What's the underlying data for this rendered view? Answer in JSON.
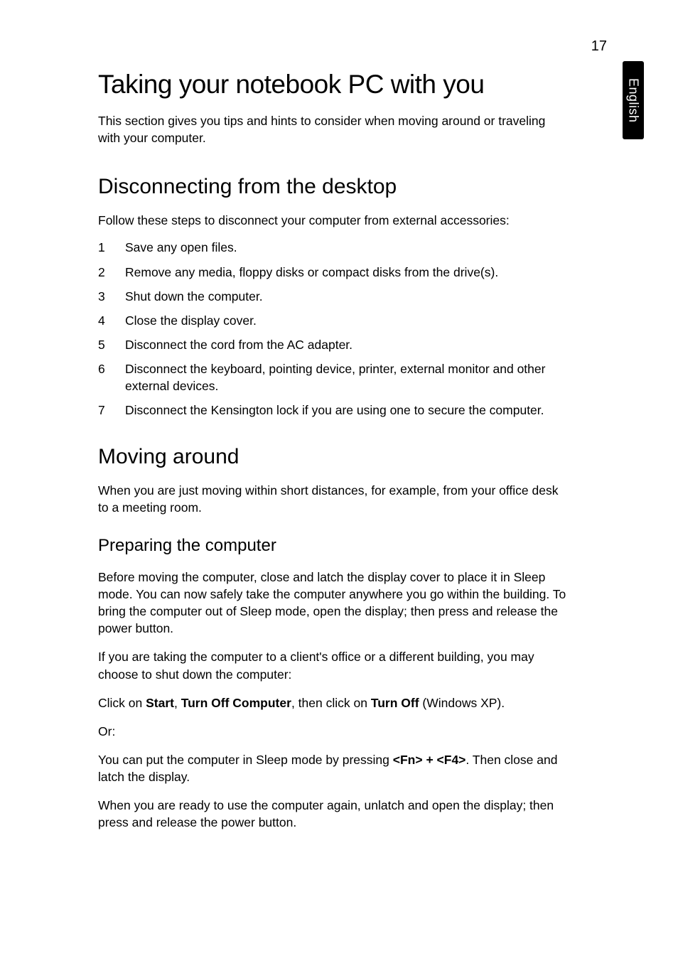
{
  "page_number": "17",
  "side_tab": "English",
  "h1": "Taking your notebook PC with you",
  "intro": "This section gives you tips and hints to consider when moving around or traveling with your computer.",
  "section1": {
    "heading": "Disconnecting from the desktop",
    "lead": "Follow these steps to disconnect your computer from external accessories:",
    "items": [
      {
        "n": "1",
        "t": "Save any open files."
      },
      {
        "n": "2",
        "t": "Remove any media, floppy disks or compact disks from the drive(s)."
      },
      {
        "n": "3",
        "t": "Shut down the computer."
      },
      {
        "n": "4",
        "t": "Close the display cover."
      },
      {
        "n": "5",
        "t": "Disconnect the cord from the AC adapter."
      },
      {
        "n": "6",
        "t": "Disconnect the keyboard, pointing device, printer, external monitor and other external devices."
      },
      {
        "n": "7",
        "t": "Disconnect the Kensington lock if you are using one to secure the computer."
      }
    ]
  },
  "section2": {
    "heading": "Moving around",
    "lead": "When you are just moving within short distances, for example, from your office desk to a meeting room.",
    "sub": {
      "heading": "Preparing the computer",
      "p1": "Before moving the computer, close and latch the display cover to place it in Sleep mode. You can now safely take the computer anywhere you go within the building. To bring the computer out of Sleep mode, open the display; then press and release the power button.",
      "p2": "If you are taking the computer to a client's office or a different building, you may choose to shut down the computer:",
      "click_line": {
        "pre": "Click on ",
        "b1": "Start",
        "c1": ", ",
        "b2": "Turn Off Computer",
        "c2": ", then click on ",
        "b3": "Turn Off",
        "post": " (Windows XP)."
      },
      "or": "Or:",
      "sleep_line": {
        "pre": "You can put the computer in Sleep mode by pressing ",
        "key": "<Fn> + <F4>",
        "post": ". Then close and latch the display."
      },
      "p_last": "When you are ready to use the computer again, unlatch and open the display; then press and release the power button."
    }
  }
}
